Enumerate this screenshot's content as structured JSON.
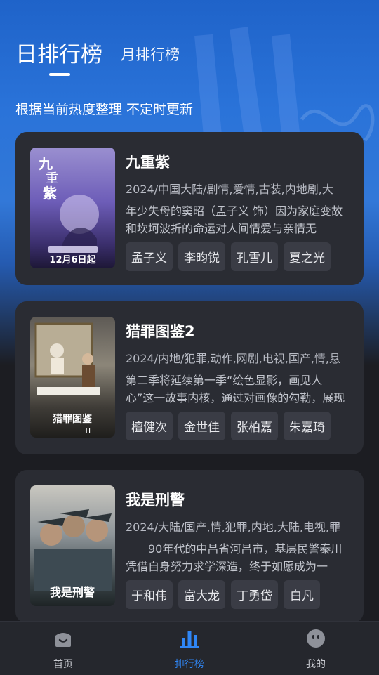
{
  "header": {
    "tab_day": "日排行榜",
    "tab_month": "月排行榜",
    "subtitle": "根据当前热度整理 不定时更新"
  },
  "cards": [
    {
      "title": "九重紫",
      "meta": "2024/中国大陆/剧情,爱情,古装,内地剧,大",
      "desc": "年少失母的窦昭（孟子义 饰）因为家庭变故和坎坷波折的命运对人间情爱与亲情无",
      "tags": [
        "孟子义",
        "李昀锐",
        "孔雪儿",
        "夏之光"
      ],
      "poster_text_top": "九重紫",
      "poster_text_bottom": "12月6日起"
    },
    {
      "title": "猎罪图鉴2",
      "meta": "2024/内地/犯罪,动作,网剧,电视,国产,情,悬",
      "desc": "第二季将延续第一季“绘色显影，画见人心”这一故事内核，通过对画像的勾勒，展现",
      "tags": [
        "檀健次",
        "金世佳",
        "张柏嘉",
        "朱嘉琦"
      ],
      "poster_text": "猎罪图鉴II"
    },
    {
      "title": "我是刑警",
      "meta": "2024/大陆/国产,情,犯罪,内地,大陆,电视,罪",
      "desc": "　　90年代的中昌省河昌市，基层民警秦川凭借自身努力求学深造，终于如愿成为一",
      "tags": [
        "于和伟",
        "富大龙",
        "丁勇岱",
        "白凡"
      ],
      "poster_text": "我是刑警"
    }
  ],
  "nav": {
    "home": "首页",
    "ranking": "排行榜",
    "mine": "我的"
  },
  "colors": {
    "accent": "#2f86f5",
    "card_bg": "#2a2c33",
    "page_bg": "#1c1d22"
  }
}
